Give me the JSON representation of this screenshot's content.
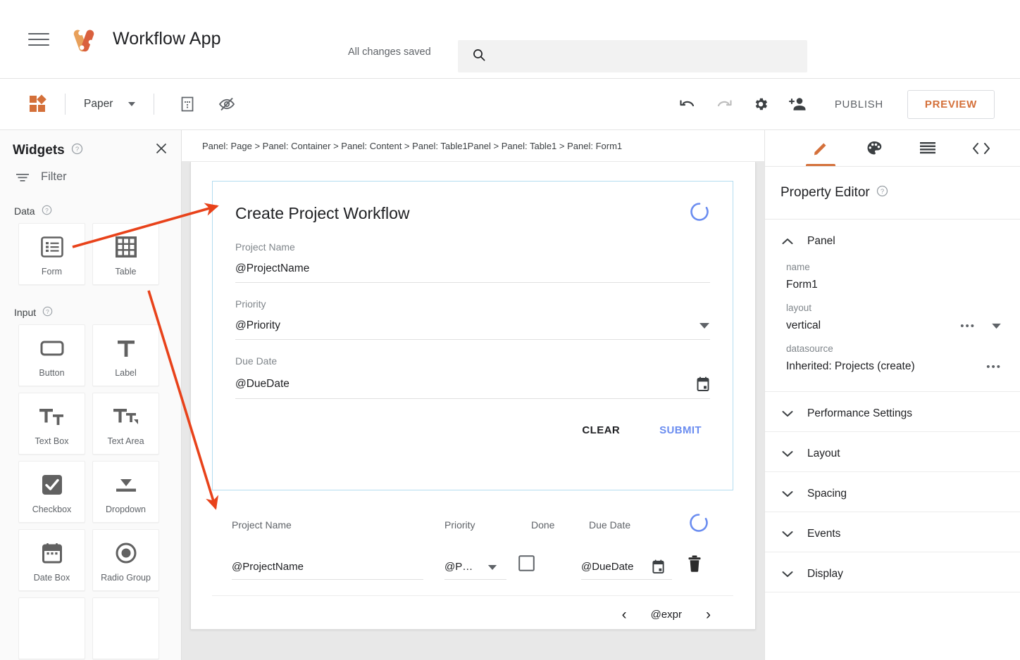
{
  "topbar": {
    "menu_icon": "hamburger-icon",
    "logo_icon": "appsheet-logo",
    "app_title": "Workflow App",
    "save_status": "All changes saved",
    "search": {
      "icon": "search-icon",
      "value": "",
      "placeholder": ""
    }
  },
  "toolbar": {
    "widgets_icon": "widgets-icon",
    "view_select": {
      "value": "Paper",
      "caret": "chevron-down-icon"
    },
    "grid_icon": "layout-grid-icon",
    "hide_icon": "visibility-off-icon",
    "undo_icon": "undo-icon",
    "redo_icon": "redo-icon",
    "settings_icon": "gear-icon",
    "share_icon": "add-person-icon",
    "publish_label": "PUBLISH",
    "preview_label": "PREVIEW",
    "preview_color": "#d4703a"
  },
  "widgets_panel": {
    "title": "Widgets",
    "help_icon": "help-circle-icon",
    "close_icon": "close-icon",
    "filter": {
      "icon": "filter-icon",
      "label": "Filter"
    },
    "groups": [
      {
        "label": "Data",
        "help_icon": "help-circle-icon",
        "items": [
          {
            "label": "Form",
            "icon": "form-icon"
          },
          {
            "label": "Table",
            "icon": "table-icon"
          }
        ]
      },
      {
        "label": "Input",
        "help_icon": "help-circle-icon",
        "items": [
          {
            "label": "Button",
            "icon": "button-icon"
          },
          {
            "label": "Label",
            "icon": "label-text-icon"
          },
          {
            "label": "Text Box",
            "icon": "textbox-icon"
          },
          {
            "label": "Text Area",
            "icon": "textarea-icon"
          },
          {
            "label": "Checkbox",
            "icon": "checkbox-icon"
          },
          {
            "label": "Dropdown",
            "icon": "dropdown-icon"
          },
          {
            "label": "Date Box",
            "icon": "calendar-icon"
          },
          {
            "label": "Radio Group",
            "icon": "radio-button-icon"
          }
        ]
      }
    ]
  },
  "canvas": {
    "breadcrumb": "Panel: Page > Panel: Container > Panel: Content > Panel: Table1Panel > Panel: Table1 > Panel: Form1",
    "form": {
      "title": "Create Project Workflow",
      "spinner_icon": "loading-spinner-icon",
      "spinner_color": "#6b8df0",
      "fields": [
        {
          "label": "Project Name",
          "value": "@ProjectName",
          "adorn": "none"
        },
        {
          "label": "Priority",
          "value": "@Priority",
          "adorn": "dropdown-caret-icon"
        },
        {
          "label": "Due Date",
          "value": "@DueDate",
          "adorn": "calendar-icon"
        }
      ],
      "clear_label": "CLEAR",
      "submit_label": "SUBMIT",
      "submit_color": "#6b8df0"
    },
    "table": {
      "spinner_icon": "loading-spinner-icon",
      "columns": [
        "Project Name",
        "Priority",
        "Done",
        "Due Date"
      ],
      "row": {
        "project_name": "@ProjectName",
        "priority": "@P…",
        "done_checked": false,
        "due_date": "@DueDate",
        "delete_icon": "trash-icon",
        "priority_caret": "dropdown-caret-icon",
        "date_icon": "calendar-icon"
      },
      "pager": {
        "prev": "‹",
        "expr": "@expr",
        "next": "›"
      }
    }
  },
  "property_panel": {
    "tabs": [
      {
        "icon": "pencil-icon",
        "active": true
      },
      {
        "icon": "palette-icon",
        "active": false
      },
      {
        "icon": "list-lines-icon",
        "active": false
      },
      {
        "icon": "code-brackets-icon",
        "active": false
      }
    ],
    "title": "Property Editor",
    "help_icon": "help-circle-icon",
    "open_section": {
      "label": "Panel",
      "chevron": "chevron-up-icon",
      "properties": [
        {
          "key": "name",
          "value": "Form1",
          "adorns": []
        },
        {
          "key": "layout",
          "value": "vertical",
          "adorns": [
            "overflow-dots-icon",
            "dropdown-caret-icon"
          ]
        },
        {
          "key": "datasource",
          "value": "Inherited: Projects (create)",
          "adorns": [
            "overflow-dots-icon"
          ]
        }
      ]
    },
    "collapsed_sections": [
      {
        "label": "Performance Settings",
        "chevron": "chevron-down-icon"
      },
      {
        "label": "Layout",
        "chevron": "chevron-down-icon"
      },
      {
        "label": "Spacing",
        "chevron": "chevron-down-icon"
      },
      {
        "label": "Events",
        "chevron": "chevron-down-icon"
      },
      {
        "label": "Display",
        "chevron": "chevron-down-icon"
      }
    ]
  },
  "annotations": {
    "arrow_color": "#e8421a",
    "arrows": [
      {
        "name": "form-widget-to-form-panel"
      },
      {
        "name": "table-widget-to-table-panel"
      }
    ]
  }
}
